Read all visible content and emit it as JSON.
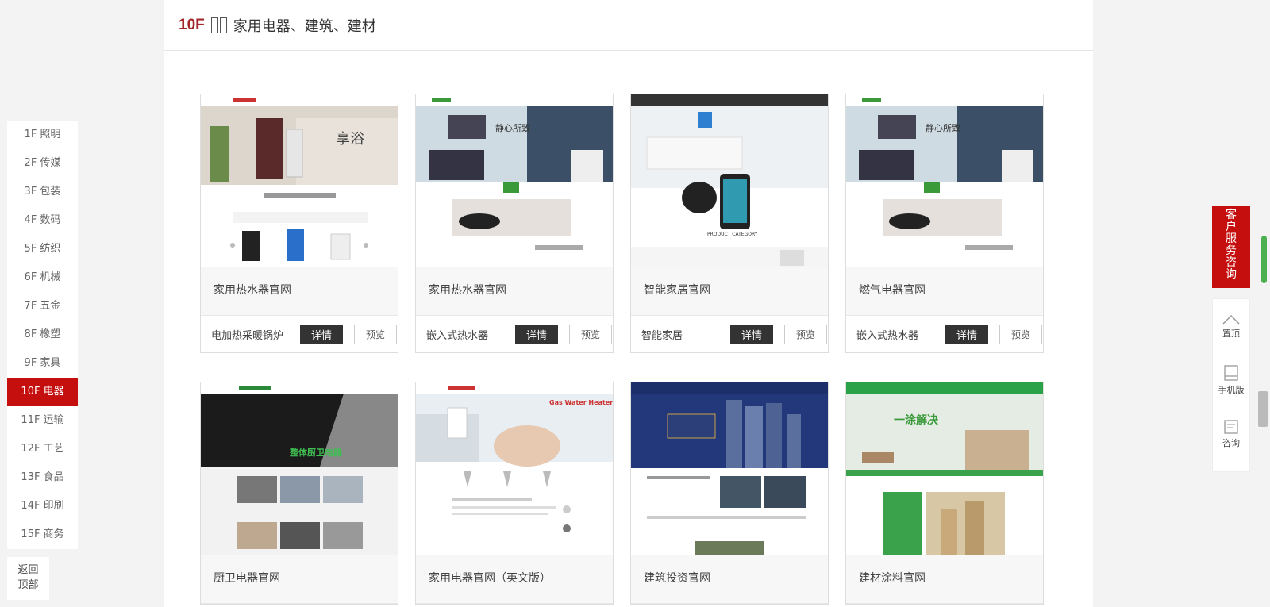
{
  "floor_nav": {
    "items": [
      {
        "label": "1F 照明"
      },
      {
        "label": "2F 传媒"
      },
      {
        "label": "3F 包装"
      },
      {
        "label": "4F 数码"
      },
      {
        "label": "5F 纺织"
      },
      {
        "label": "6F 机械"
      },
      {
        "label": "7F 五金"
      },
      {
        "label": "8F 橡塑"
      },
      {
        "label": "9F 家具"
      },
      {
        "label": "10F 电器",
        "active": true
      },
      {
        "label": "11F 运输"
      },
      {
        "label": "12F 工艺"
      },
      {
        "label": "13F 食品"
      },
      {
        "label": "14F 印刷"
      },
      {
        "label": "15F 商务"
      }
    ],
    "back_top_line1": "返回",
    "back_top_line2": "顶部"
  },
  "floor": {
    "number": "10F",
    "title": "家用电器、建筑、建材"
  },
  "cards": [
    {
      "name": "家用热水器官网",
      "category": "电加热采暖锅炉",
      "detail": "详情",
      "preview": "预览"
    },
    {
      "name": "家用热水器官网",
      "category": "嵌入式热水器",
      "detail": "详情",
      "preview": "预览"
    },
    {
      "name": "智能家居官网",
      "category": "智能家居",
      "detail": "详情",
      "preview": "预览"
    },
    {
      "name": "燃气电器官网",
      "category": "嵌入式热水器",
      "detail": "详情",
      "preview": "预览"
    },
    {
      "name": "厨卫电器官网",
      "category": "",
      "detail": "",
      "preview": ""
    },
    {
      "name": "家用电器官网（英文版）",
      "category": "",
      "detail": "",
      "preview": ""
    },
    {
      "name": "建筑投资官网",
      "category": "",
      "detail": "",
      "preview": ""
    },
    {
      "name": "建材涂料官网",
      "category": "",
      "detail": "",
      "preview": ""
    }
  ],
  "thumb_text": {
    "t1": "享浴",
    "t2": "静心所致",
    "t3": "PRODUCT CATEGORY",
    "t5": "整体厨卫电器",
    "t6": "Gas Water Heater",
    "t8": "一涂解决"
  },
  "right_tools": {
    "service": "客户服务咨询",
    "top": "置顶",
    "mobile": "手机版",
    "consult": "咨询"
  },
  "colors": {
    "accent": "#c50e0e",
    "floor_num": "#a3262a",
    "dark_button": "#333333"
  }
}
